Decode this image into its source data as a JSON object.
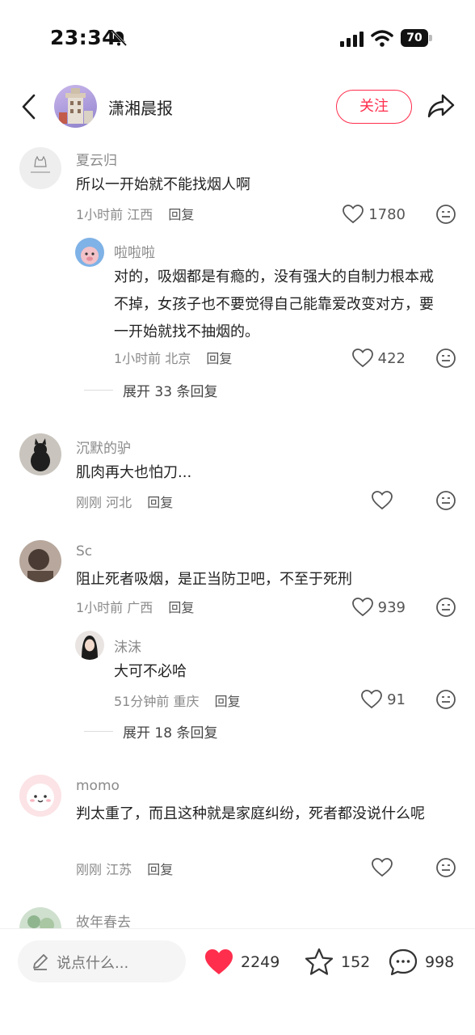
{
  "status_bar": {
    "time": "23:34",
    "battery": "70"
  },
  "header": {
    "account_name": "潇湘晨报",
    "follow_label": "关注"
  },
  "comments": [
    {
      "name": "夏云归",
      "text": "所以一开始就不能找烟人啊",
      "time": "1小时前",
      "location": "江西",
      "reply_label": "回复",
      "likes": "1780"
    },
    {
      "name": "啦啦啦",
      "text": "对的，吸烟都是有瘾的，没有强大的自制力根本戒不掉，女孩子也不要觉得自己能靠爱改变对方，要一开始就找不抽烟的。",
      "time": "1小时前",
      "location": "北京",
      "reply_label": "回复",
      "likes": "422"
    },
    {
      "name": "沉默的驴",
      "text": "肌肉再大也怕刀...",
      "time": "刚刚",
      "location": "河北",
      "reply_label": "回复",
      "likes": ""
    },
    {
      "name": "Sc",
      "text": "阻止死者吸烟，是正当防卫吧，不至于死刑",
      "time": "1小时前",
      "location": "广西",
      "reply_label": "回复",
      "likes": "939"
    },
    {
      "name": "沫沫",
      "text": "大可不必哈",
      "time": "51分钟前",
      "location": "重庆",
      "reply_label": "回复",
      "likes": "91"
    },
    {
      "name": "momo",
      "text": "判太重了，而且这种就是家庭纠纷，死者都没说什么呢",
      "time": "刚刚",
      "location": "江苏",
      "reply_label": "回复",
      "likes": ""
    },
    {
      "name": "故年春去"
    }
  ],
  "expand_replies": [
    {
      "label": "展开 33 条回复"
    },
    {
      "label": "展开 18 条回复"
    }
  ],
  "bottom_bar": {
    "input_placeholder": "说点什么...",
    "like_count": "2249",
    "favorite_count": "152",
    "comment_count": "998"
  },
  "colors": {
    "accent": "#ff2e4d",
    "muted": "#8a8a8a"
  },
  "icons": [
    "back-icon",
    "share-icon",
    "heart-icon",
    "dislike-icon",
    "pen-icon",
    "star-icon",
    "comment-bubble-icon"
  ]
}
